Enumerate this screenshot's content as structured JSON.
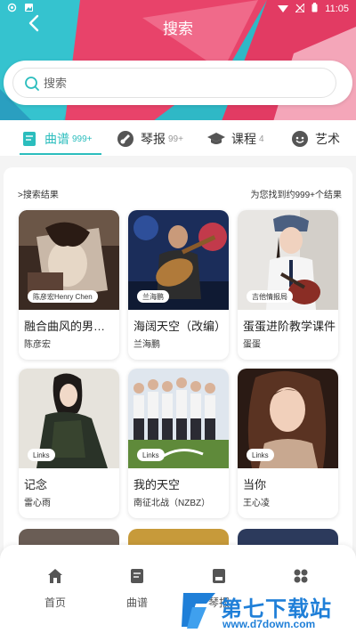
{
  "status_bar": {
    "time": "11:05"
  },
  "header": {
    "title": "搜索"
  },
  "search": {
    "placeholder": "搜索"
  },
  "tabs": [
    {
      "label": "曲谱",
      "count": "999+",
      "icon": "score-icon",
      "active": true
    },
    {
      "label": "琴报",
      "count": "99+",
      "icon": "guitar-news-icon",
      "active": false
    },
    {
      "label": "课程",
      "count": "4",
      "icon": "course-cap-icon",
      "active": false
    },
    {
      "label": "艺术",
      "count": "",
      "icon": "artist-icon",
      "active": false
    }
  ],
  "results": {
    "heading": ">搜索结果",
    "summary": "为您找到约999+个结果",
    "items": [
      {
        "title": "融合曲风的男孩 ...",
        "author": "陈彦宏",
        "badge": "陈彦宏Henry Chen"
      },
      {
        "title": "海阔天空（改编）",
        "author": "兰海鹏",
        "badge": "兰海鹏"
      },
      {
        "title": "蛋蛋进阶教学课件",
        "author": "蛋蛋",
        "badge": "吉他情报局"
      },
      {
        "title": "记念",
        "author": "雷心雨",
        "badge": "Links"
      },
      {
        "title": "我的天空",
        "author": "南征北战（NZBZ）",
        "badge": "Links"
      },
      {
        "title": "当你",
        "author": "王心凌",
        "badge": "Links"
      }
    ]
  },
  "bottom_nav": [
    {
      "label": "首页",
      "icon": "home-icon"
    },
    {
      "label": "曲谱",
      "icon": "score-icon"
    },
    {
      "label": "琴报",
      "icon": "news-icon"
    },
    {
      "label": "",
      "icon": "apps-icon"
    }
  ],
  "watermark": {
    "title": "第七下载站",
    "url": "www.d7down.com"
  },
  "colors": {
    "accent": "#2bbdbd",
    "hero_teal": "#2fb8c6",
    "hero_pink": "#e8436a",
    "watermark": "#1f7fd8"
  }
}
